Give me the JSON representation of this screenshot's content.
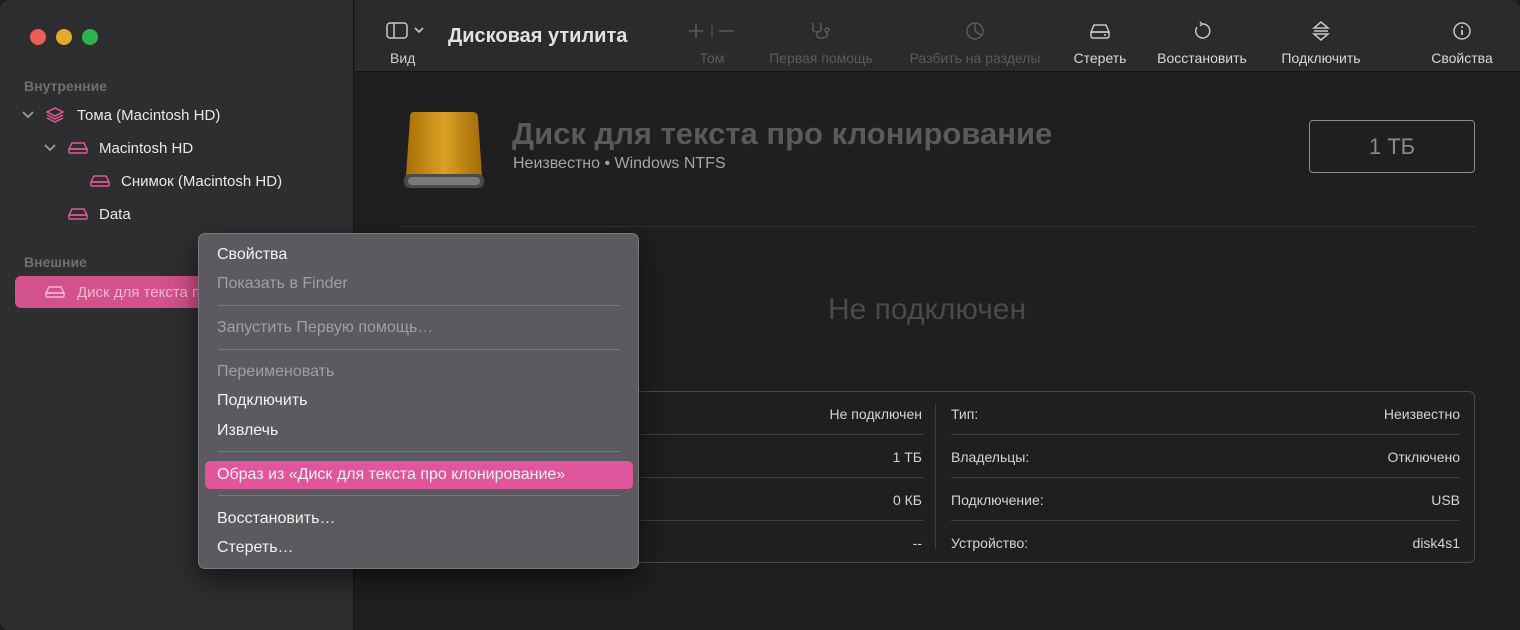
{
  "window": {
    "traffic_lights": {
      "close": "#ec5f57",
      "minimize": "#dfaa2d",
      "zoom": "#2cb54a"
    }
  },
  "sidebar": {
    "internal_header": "Внутренние",
    "internal_items": [
      {
        "label": "Тома (Macintosh HD)",
        "icon": "layers-icon"
      },
      {
        "label": "Macintosh HD",
        "icon": "drive-icon"
      },
      {
        "label": "Снимок (Macintosh HD)",
        "icon": "drive-icon"
      },
      {
        "label": "Data",
        "icon": "drive-icon"
      }
    ],
    "external_header": "Внешние",
    "external_selected": {
      "label": "Диск для текста про клонирование",
      "icon": "drive-icon"
    },
    "accent_color": "#d3518c"
  },
  "toolbar": {
    "view_label": "Вид",
    "app_title": "Дисковая утилита",
    "buttons": [
      {
        "label": "Том",
        "icon": "plus-minus-icon",
        "enabled": false
      },
      {
        "label": "Первая помощь",
        "icon": "stethoscope-icon",
        "enabled": false
      },
      {
        "label": "Разбить на разделы",
        "icon": "pie-icon",
        "enabled": false
      },
      {
        "label": "Стереть",
        "icon": "eraser-drive-icon",
        "enabled": true
      },
      {
        "label": "Восстановить",
        "icon": "restore-icon",
        "enabled": true
      },
      {
        "label": "Подключить",
        "icon": "mount-icon",
        "enabled": true
      },
      {
        "label": "Свойства",
        "icon": "info-icon",
        "enabled": true
      }
    ]
  },
  "disk": {
    "name": "Диск для текста про клонирование",
    "subtitle": "Неизвестно • Windows NTFS",
    "capacity": "1 ТБ",
    "status": "Не подключен"
  },
  "info_table": {
    "left_values": [
      "Не подключен",
      "1 ТБ",
      "0 КБ",
      "--"
    ],
    "right": [
      {
        "label": "Тип:",
        "value": "Неизвестно"
      },
      {
        "label": "Владельцы:",
        "value": "Отключено"
      },
      {
        "label": "Подключение:",
        "value": "USB"
      },
      {
        "label": "Устройство:",
        "value": "disk4s1"
      }
    ]
  },
  "context_menu": {
    "items": [
      {
        "label": "Свойства",
        "enabled": true
      },
      {
        "label": "Показать в Finder",
        "enabled": false
      },
      {
        "label": "Запустить Первую помощь…",
        "enabled": false
      },
      {
        "label": "Переименовать",
        "enabled": false
      },
      {
        "label": "Подключить",
        "enabled": true
      },
      {
        "label": "Извлечь",
        "enabled": true
      },
      {
        "label": "Образ из «Диск для текста про клонирование»",
        "enabled": true,
        "highlighted": true
      },
      {
        "label": "Восстановить…",
        "enabled": true
      },
      {
        "label": "Стереть…",
        "enabled": true
      }
    ],
    "highlight_color": "#e0559b"
  }
}
